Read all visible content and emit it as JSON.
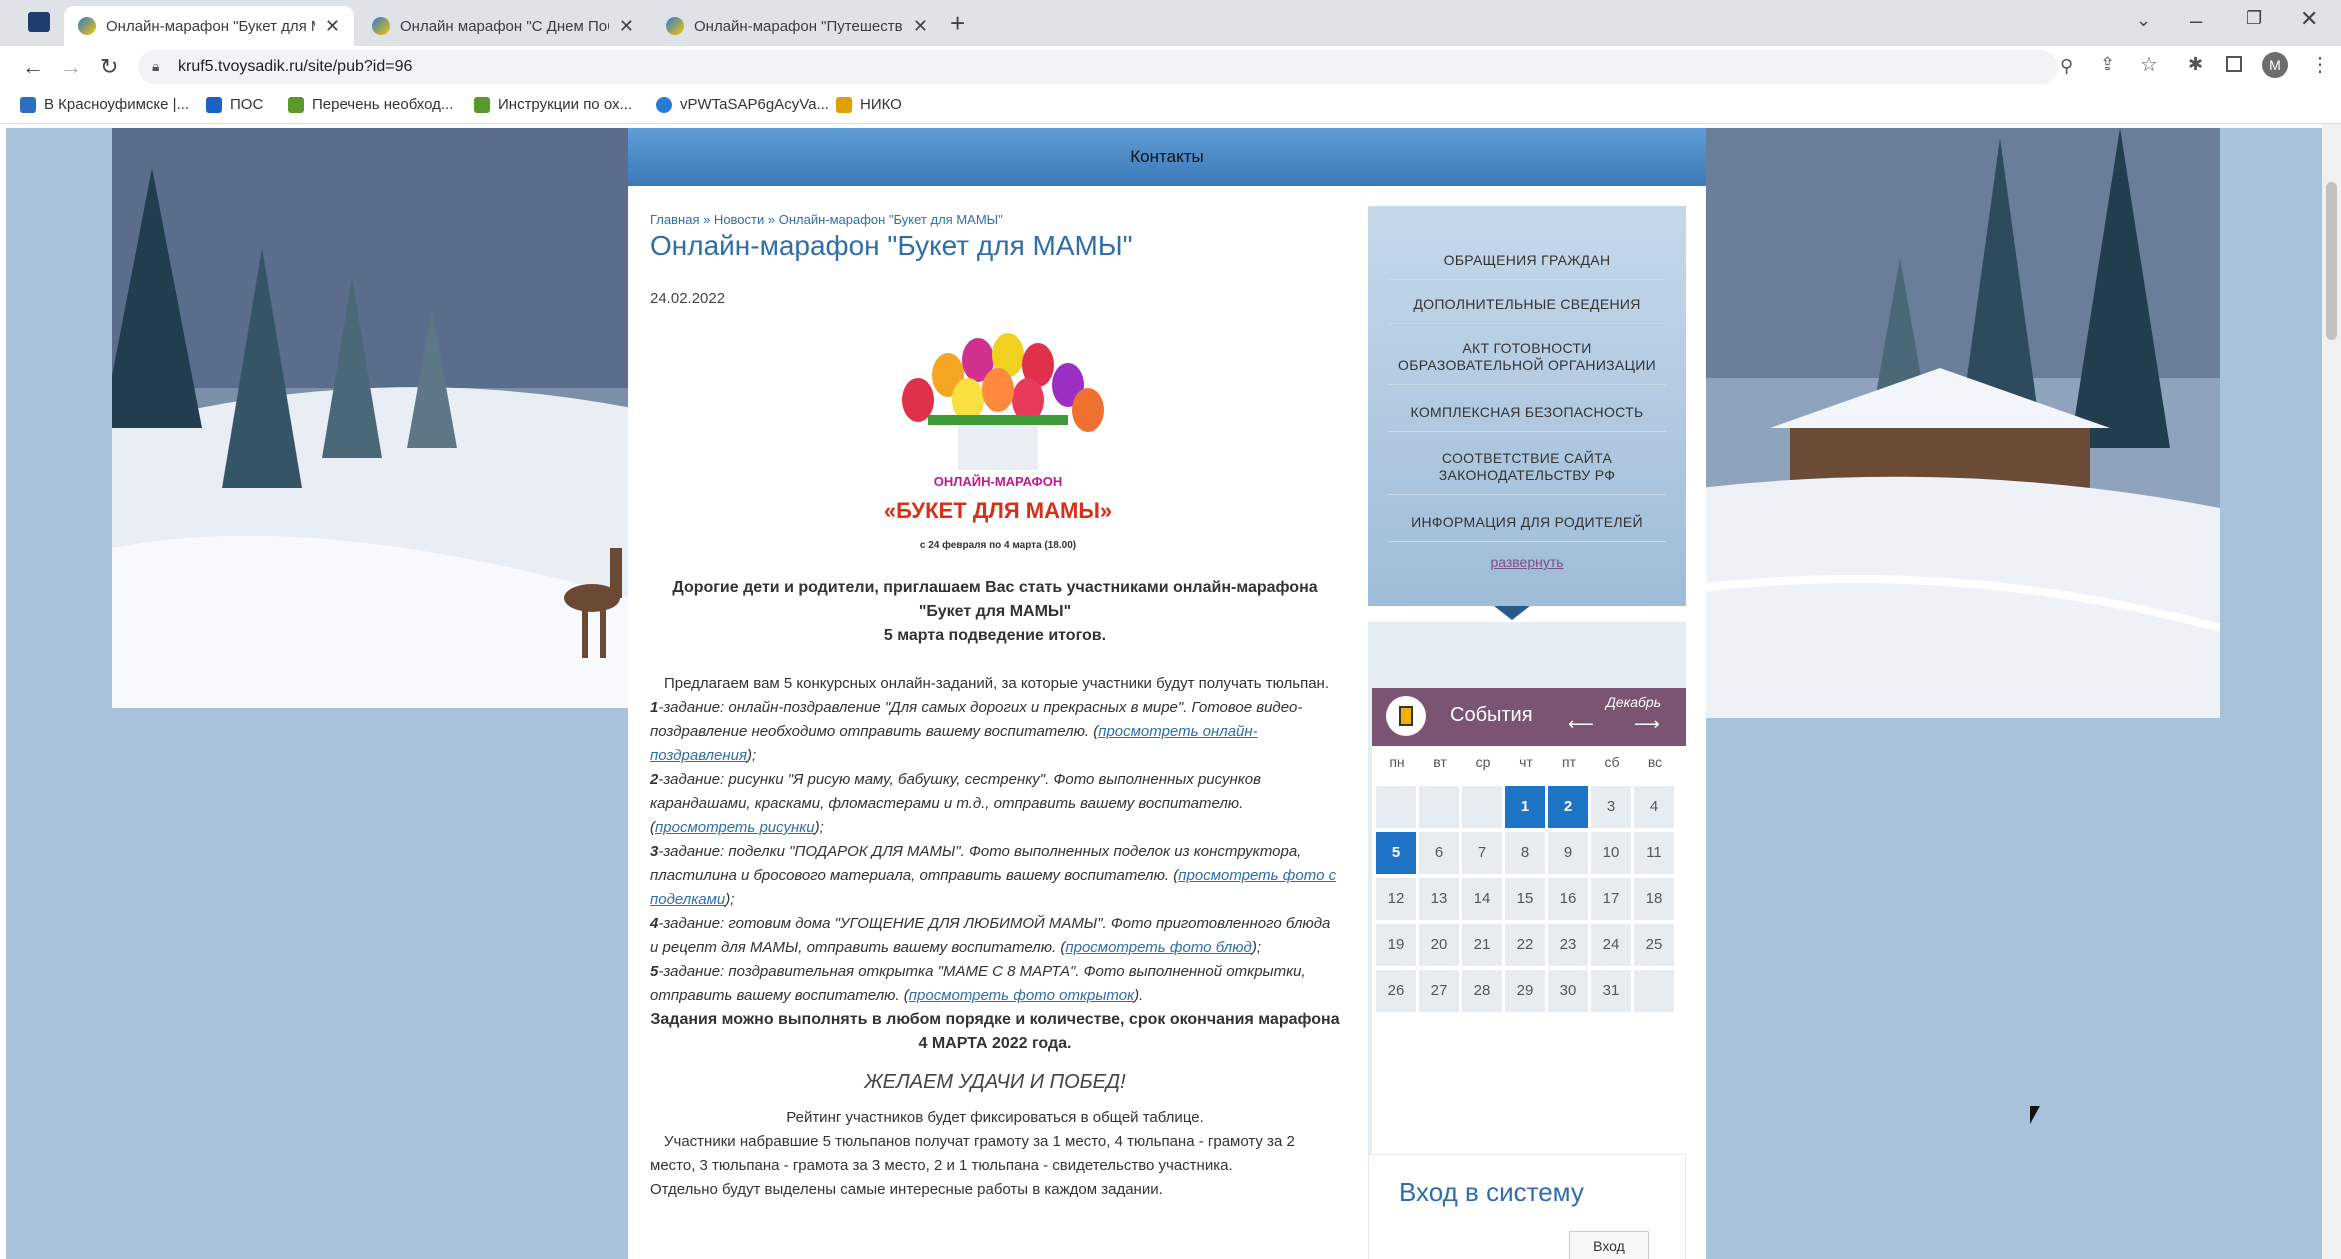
{
  "browser": {
    "tabs": [
      {
        "label": "Онлайн-марафон \"Букет для МАМЫ\""
      },
      {
        "label": "Онлайн марафон \"С Днем Победы\""
      },
      {
        "label": "Онлайн-марафон \"Путешествие\""
      }
    ],
    "new_tab": "+",
    "close_glyph": "✕",
    "url": "kruf5.tvoysadik.ru/site/pub?id=96",
    "profile_initial": "M"
  },
  "bookmarks": [
    {
      "label": "В Красноуфимске |...",
      "color": "#2a6ec2"
    },
    {
      "label": "ПОС",
      "color": "#1a62c4"
    },
    {
      "label": "Перечень необход...",
      "color": "#5a9a2b"
    },
    {
      "label": "Инструкции по ох...",
      "color": "#5a9a2b"
    },
    {
      "label": "vPWTaSAP6gAcyVa...",
      "color": "#2a7bd5"
    },
    {
      "label": "НИКО",
      "color": "#e0a000"
    }
  ],
  "site": {
    "nav_contacts": "Контакты",
    "breadcrumb": "Главная » Новости » Онлайн-марафон \"Букет для МАМЫ\"",
    "title": "Онлайн-марафон \"Букет для МАМЫ\"",
    "date": "24.02.2022",
    "poster": {
      "line1": "ОНЛАЙН-МАРАФОН",
      "line2": "«БУКЕТ ДЛЯ МАМЫ»",
      "line3": "с 24 февраля по 4 марта (18.00)"
    },
    "intro": "Дорогие дети и родители, приглашаем Вас стать участниками онлайн-марафона \"Букет для МАМЫ\"",
    "intro2": "5 марта подведение итогов.",
    "para_offer": "Предлагаем вам 5 конкурсных онлайн-заданий, за которые участники будут получать тюльпан.",
    "tasks": [
      {
        "num": "1",
        "text": "-задание: онлайн-поздравление \"Для самых дорогих и прекрасных в мире\". Готовое видео-поздравление необходимо отправить вашему воспитателю. (",
        "link": "просмотреть онлайн-поздравления",
        "end": ");"
      },
      {
        "num": "2",
        "text": "-задание: рисунки \"Я рисую маму, бабушку, сестренку\". Фото выполненных рисунков карандашами, красками, фломастерами и т.д., отправить вашему воспитателю.(",
        "link": "просмотреть рисунки",
        "end": ");"
      },
      {
        "num": "3",
        "text": "-задание: поделки \"ПОДАРОК ДЛЯ МАМЫ\". Фото выполненных поделок из конструктора, пластилина и бросового материала, отправить вашему воспитателю. (",
        "link": "просмотреть фото с поделками",
        "end": ");"
      },
      {
        "num": "4",
        "text": "-задание: готовим дома \"УГОЩЕНИЕ ДЛЯ ЛЮБИМОЙ МАМЫ\". Фото приготовленного блюда и рецепт для МАМЫ, отправить вашему воспитателю. (",
        "link": "просмотреть фото блюд",
        "end": ");"
      },
      {
        "num": "5",
        "text": "-задание: поздравительная открытка \"МАМЕ С 8 МАРТА\". Фото выполненной открытки, отправить вашему воспитателю. (",
        "link": "просмотреть фото открыток",
        "end": ")."
      }
    ],
    "deadline": "Задания можно выполнять в любом порядке и количестве, срок окончания марафона 4 МАРТА 2022 года.",
    "wish": "ЖЕЛАЕМ УДАЧИ И ПОБЕД!",
    "rating": "Рейтинг участников будет фиксироваться в общей таблице.",
    "awards": "Участники набравшие 5 тюльпанов получат грамоту за 1 место, 4 тюльпана - грамоту за 2 место, 3 тюльпана - грамота за 3 место, 2 и 1 тюльпана - свидетельство участника.",
    "special": "Отдельно будут выделены самые интересные работы в каждом задании."
  },
  "sidebar": {
    "items": [
      "ОБРАЩЕНИЯ ГРАЖДАН",
      "ДОПОЛНИТЕЛЬНЫЕ СВЕДЕНИЯ",
      "АКТ ГОТОВНОСТИ ОБРАЗОВАТЕЛЬНОЙ ОРГАНИЗАЦИИ",
      "КОМПЛЕКСНАЯ БЕЗОПАСНОСТЬ",
      "СООТВЕТСТВИЕ САЙТА ЗАКОНОДАТЕЛЬСТВУ РФ",
      "ИНФОРМАЦИЯ ДЛЯ РОДИТЕЛЕЙ"
    ],
    "expand": "развернуть"
  },
  "calendar": {
    "title": "События",
    "month": "Декабрь",
    "prev": "⟵",
    "next": "⟶",
    "weekdays": [
      "пн",
      "вт",
      "ср",
      "чт",
      "пт",
      "сб",
      "вс"
    ],
    "weeks": [
      [
        "",
        "",
        "",
        "1",
        "2",
        "3",
        "4"
      ],
      [
        "5",
        "6",
        "7",
        "8",
        "9",
        "10",
        "11"
      ],
      [
        "12",
        "13",
        "14",
        "15",
        "16",
        "17",
        "18"
      ],
      [
        "19",
        "20",
        "21",
        "22",
        "23",
        "24",
        "25"
      ],
      [
        "26",
        "27",
        "28",
        "29",
        "30",
        "31",
        ""
      ]
    ],
    "highlighted": [
      "1",
      "2",
      "5"
    ]
  },
  "login": {
    "title": "Вход в систему",
    "button": "Вход"
  },
  "colors": {
    "accent": "#2f6ea8",
    "nav": "#3b78b8",
    "calendar_header": "#7b5373",
    "highlight": "#1d74c4"
  }
}
